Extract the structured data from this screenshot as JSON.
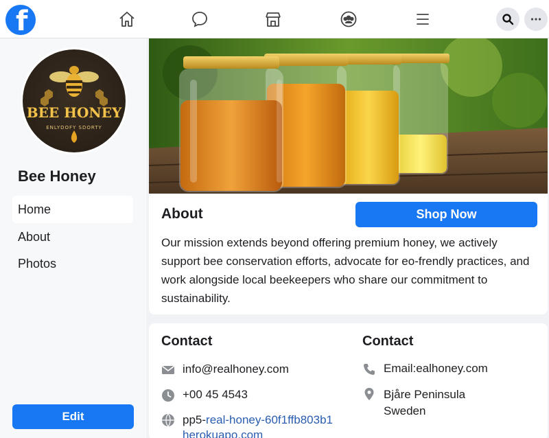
{
  "nav": {
    "logo_letter": "f",
    "icons": [
      "home-icon",
      "messenger-icon",
      "marketplace-icon",
      "groups-icon",
      "menu-icon"
    ],
    "right_icons": [
      "search-icon",
      "more-icon"
    ]
  },
  "sidebar": {
    "avatar": {
      "brand": "BEE HONEY",
      "sub": "ENLYDOFY  SDORTY"
    },
    "page_name": "Bee Honey",
    "items": [
      {
        "label": "Home",
        "active": true
      },
      {
        "label": "About",
        "active": false
      },
      {
        "label": "Photos",
        "active": false
      }
    ],
    "edit_label": "Edit"
  },
  "about": {
    "title": "About",
    "shop_label": "Shop Now",
    "text": "Our mission extends beyond offering premium honey, we actively support bee conservation efforts, advocate for eo-frendly practices, and work alongside local beekeepers who share our commitment to sustainability."
  },
  "contact": {
    "left_title": "Contact",
    "right_title": "Contact",
    "email": "info@realhoney.com",
    "phone": "+00 45 4543",
    "website_prefix": "pp5-",
    "website_link_1": "real-honey-60f1ffb803b1",
    "website_link_2": "herokuapo.com",
    "right_email": "Email:ealhoney.com",
    "location_1": "Bjåre Peninsula",
    "location_2": "Sweden"
  },
  "colors": {
    "brand": "#1877f2",
    "link": "#2a5db0",
    "background": "#f0f2f5"
  }
}
